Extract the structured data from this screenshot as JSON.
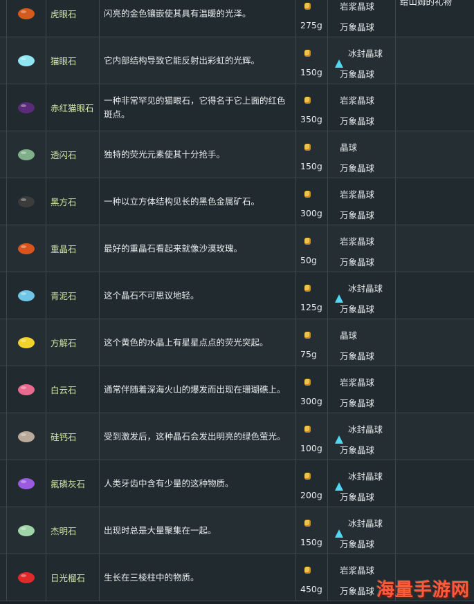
{
  "rows": [
    {
      "name": "虎眼石",
      "desc": "闪亮的金色镶嵌使其具有温暖的光泽。",
      "price": "275g",
      "ing1": {
        "label": "岩浆晶球",
        "icon": "magma-orb-icon",
        "kind": "red"
      },
      "ing2": {
        "label": "万象晶球",
        "icon": "omni-geode-icon",
        "kind": "prism"
      },
      "gift": "给山姆的礼物",
      "gem": "tigers-eye-icon",
      "color": "#d45a1e"
    },
    {
      "name": "猫眼石",
      "desc": "它内部结构导致它能反射出彩虹的光辉。",
      "price": "150g",
      "ing1": {
        "label": "冰封晶球",
        "icon": "frozen-orb-icon",
        "kind": "ice"
      },
      "ing2": {
        "label": "万象晶球",
        "icon": "omni-geode-icon",
        "kind": "prism"
      },
      "gift": "",
      "gem": "opal-icon",
      "color": "#8fe6f2"
    },
    {
      "name": "赤红猫眼石",
      "desc": "一种非常罕见的猫眼石，它得名于它上面的红色斑点。",
      "price": "350g",
      "ing1": {
        "label": "岩浆晶球",
        "icon": "magma-orb-icon",
        "kind": "red"
      },
      "ing2": {
        "label": "万象晶球",
        "icon": "omni-geode-icon",
        "kind": "prism"
      },
      "gift": "",
      "gem": "fire-opal-icon",
      "color": "#5b2a7a"
    },
    {
      "name": "透闪石",
      "desc": "独特的荧光元素使其十分抢手。",
      "price": "150g",
      "ing1": {
        "label": "晶球",
        "icon": "geode-icon",
        "kind": "brown"
      },
      "ing2": {
        "label": "万象晶球",
        "icon": "omni-geode-icon",
        "kind": "prism"
      },
      "gift": "",
      "gem": "tremolite-icon",
      "color": "#7fb08a"
    },
    {
      "name": "黑方石",
      "desc": "一种以立方体结构见长的黑色金属矿石。",
      "price": "300g",
      "ing1": {
        "label": "岩浆晶球",
        "icon": "magma-orb-icon",
        "kind": "red"
      },
      "ing2": {
        "label": "万象晶球",
        "icon": "omni-geode-icon",
        "kind": "prism"
      },
      "gift": "",
      "gem": "nekoite-icon",
      "color": "#3c3c3c"
    },
    {
      "name": "重晶石",
      "desc": "最好的重晶石看起来就像沙漠玫瑰。",
      "price": "50g",
      "ing1": {
        "label": "岩浆晶球",
        "icon": "magma-orb-icon",
        "kind": "red"
      },
      "ing2": {
        "label": "万象晶球",
        "icon": "omni-geode-icon",
        "kind": "prism"
      },
      "gift": "",
      "gem": "baryte-icon",
      "color": "#d9531c"
    },
    {
      "name": "青泥石",
      "desc": "这个晶石不可思议地轻。",
      "price": "125g",
      "ing1": {
        "label": "冰封晶球",
        "icon": "frozen-orb-icon",
        "kind": "ice"
      },
      "ing2": {
        "label": "万象晶球",
        "icon": "omni-geode-icon",
        "kind": "prism"
      },
      "gift": "",
      "gem": "celestine-icon",
      "color": "#6fc5e8"
    },
    {
      "name": "方解石",
      "desc": "这个黄色的水晶上有星星点点的荧光突起。",
      "price": "75g",
      "ing1": {
        "label": "晶球",
        "icon": "geode-icon",
        "kind": "brown"
      },
      "ing2": {
        "label": "万象晶球",
        "icon": "omni-geode-icon",
        "kind": "prism"
      },
      "gift": "",
      "gem": "calcite-icon",
      "color": "#f2d22b"
    },
    {
      "name": "白云石",
      "desc": "通常伴随着深海火山的爆发而出现在珊瑚礁上。",
      "price": "300g",
      "ing1": {
        "label": "岩浆晶球",
        "icon": "magma-orb-icon",
        "kind": "red"
      },
      "ing2": {
        "label": "万象晶球",
        "icon": "omni-geode-icon",
        "kind": "prism"
      },
      "gift": "",
      "gem": "dolomite-icon",
      "color": "#e86a8c"
    },
    {
      "name": "硅钙石",
      "desc": "受到激发后，这种晶石会发出明亮的绿色萤光。",
      "price": "100g",
      "ing1": {
        "label": "冰封晶球",
        "icon": "frozen-orb-icon",
        "kind": "ice"
      },
      "ing2": {
        "label": "万象晶球",
        "icon": "omni-geode-icon",
        "kind": "prism"
      },
      "gift": "",
      "gem": "esperite-icon",
      "color": "#b9a99a"
    },
    {
      "name": "氟磷灰石",
      "desc": "人类牙齿中含有少量的这种物质。",
      "price": "200g",
      "ing1": {
        "label": "冰封晶球",
        "icon": "frozen-orb-icon",
        "kind": "ice"
      },
      "ing2": {
        "label": "万象晶球",
        "icon": "omni-geode-icon",
        "kind": "prism"
      },
      "gift": "",
      "gem": "fluorapatite-icon",
      "color": "#9a5be0"
    },
    {
      "name": "杰明石",
      "desc": "出现时总是大量聚集在一起。",
      "price": "150g",
      "ing1": {
        "label": "冰封晶球",
        "icon": "frozen-orb-icon",
        "kind": "ice"
      },
      "ing2": {
        "label": "万象晶球",
        "icon": "omni-geode-icon",
        "kind": "prism"
      },
      "gift": "",
      "gem": "geminite-icon",
      "color": "#9fd3a9"
    },
    {
      "name": "日光榴石",
      "desc": "生长在三棱柱中的物质。",
      "price": "450g",
      "ing1": {
        "label": "岩浆晶球",
        "icon": "magma-orb-icon",
        "kind": "red"
      },
      "ing2": {
        "label": "万象晶球",
        "icon": "omni-geode-icon",
        "kind": "prism"
      },
      "gift": "",
      "gem": "helvite-icon",
      "color": "#e02a2a"
    }
  ],
  "watermark": "海量手游网"
}
